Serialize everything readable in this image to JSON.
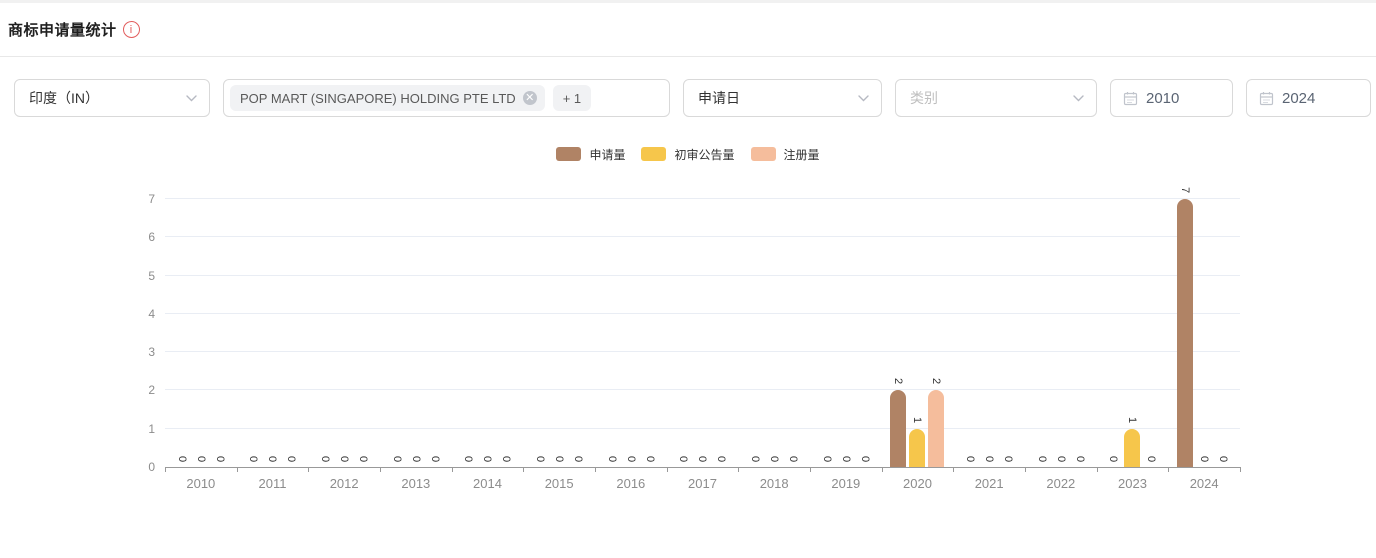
{
  "header": {
    "title": "商标申请量统计",
    "info_icon": "info-circle"
  },
  "filters": {
    "country": {
      "value": "印度（IN）"
    },
    "applicant": {
      "tags": [
        {
          "label": "POP MART (SINGAPORE) HOLDING PTE LTD",
          "closable": true
        }
      ],
      "more_tag": "+ 1"
    },
    "date_type": {
      "value": "申请日"
    },
    "category": {
      "placeholder": "类别"
    },
    "year_start": {
      "value": "2010"
    },
    "year_end": {
      "value": "2024"
    }
  },
  "ui_colors": {
    "accent_info": "#e25d5d",
    "border": "#d9d9d9",
    "gridline": "#e9edf4",
    "axis": "#999999",
    "axis_text": "#8c8c8c"
  },
  "chart_data": {
    "type": "bar",
    "categories": [
      "2010",
      "2011",
      "2012",
      "2013",
      "2014",
      "2015",
      "2016",
      "2017",
      "2018",
      "2019",
      "2020",
      "2021",
      "2022",
      "2023",
      "2024"
    ],
    "series": [
      {
        "name": "申请量",
        "color": "#B08365",
        "values": [
          0,
          0,
          0,
          0,
          0,
          0,
          0,
          0,
          0,
          0,
          2,
          0,
          0,
          0,
          7
        ]
      },
      {
        "name": "初审公告量",
        "color": "#F6C64B",
        "values": [
          0,
          0,
          0,
          0,
          0,
          0,
          0,
          0,
          0,
          0,
          1,
          0,
          0,
          1,
          0
        ]
      },
      {
        "name": "注册量",
        "color": "#F5BD9C",
        "values": [
          0,
          0,
          0,
          0,
          0,
          0,
          0,
          0,
          0,
          0,
          2,
          0,
          0,
          0,
          0
        ]
      }
    ],
    "title": "",
    "xlabel": "",
    "ylabel": "",
    "ylim": [
      0,
      7
    ],
    "y_ticks": [
      0,
      1,
      2,
      3,
      4,
      5,
      6,
      7
    ],
    "grid": true,
    "legend_position": "top-center",
    "value_label_rotation": 90
  }
}
